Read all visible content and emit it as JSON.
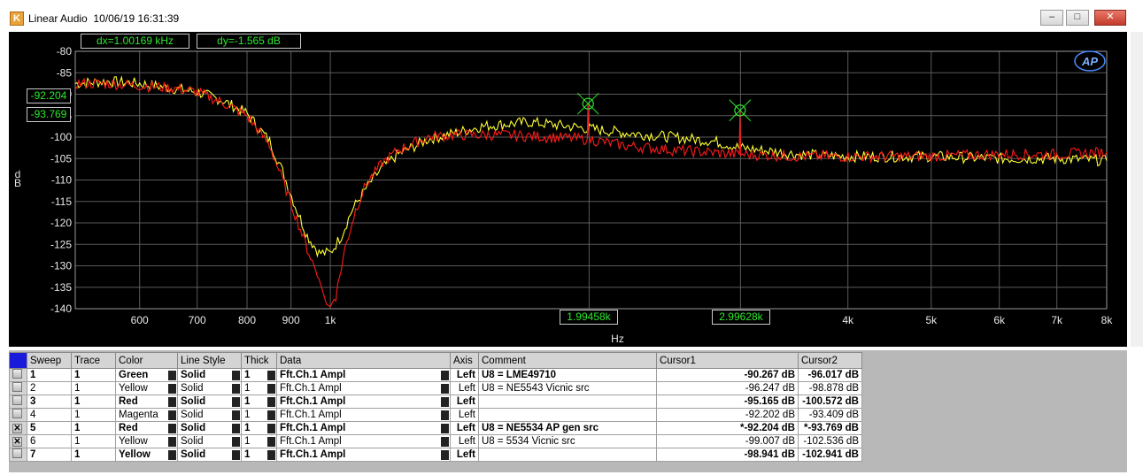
{
  "window": {
    "title": "Linear Audio",
    "timestamp": "10/06/19 16:31:39",
    "min": "–",
    "max": "□",
    "close": "✕"
  },
  "logo": "AP",
  "readouts": {
    "dx": "dx=1.00169 kHz",
    "dy": "dy=-1.565   dB",
    "cursor1_y": "-92.204",
    "cursor2_y": "-93.769",
    "cursor1_x": "1.99458k",
    "cursor2_x": "2.99628k"
  },
  "colors": {
    "yellow": "#ffff33",
    "red": "#ff1a1a",
    "green": "#2ee82e",
    "grid": "#5a5a5a"
  },
  "chart_data": {
    "type": "line",
    "xlabel": "Hz",
    "ylabel": "d\nB",
    "xscale": "log",
    "xlim": [
      505,
      8000
    ],
    "ylim": [
      -140,
      -80
    ],
    "yticks": [
      -80,
      -85,
      -90,
      -95,
      -100,
      -105,
      -110,
      -115,
      -120,
      -125,
      -130,
      -135,
      -140
    ],
    "xticks": [
      {
        "v": 600,
        "label": "600"
      },
      {
        "v": 700,
        "label": "700"
      },
      {
        "v": 800,
        "label": "800"
      },
      {
        "v": 900,
        "label": "900"
      },
      {
        "v": 1000,
        "label": "1k"
      },
      {
        "v": 2000,
        "label": ""
      },
      {
        "v": 3000,
        "label": ""
      },
      {
        "v": 4000,
        "label": "4k"
      },
      {
        "v": 5000,
        "label": "5k"
      },
      {
        "v": 6000,
        "label": "6k"
      },
      {
        "v": 7000,
        "label": "7k"
      },
      {
        "v": 8000,
        "label": "8k"
      }
    ],
    "cursors": [
      {
        "x": 1994.58,
        "y": -92.204
      },
      {
        "x": 2996.28,
        "y": -93.769
      }
    ],
    "series": [
      {
        "color": "yellow",
        "points": [
          [
            505,
            -87.5
          ],
          [
            550,
            -87
          ],
          [
            600,
            -87.5
          ],
          [
            650,
            -88.5
          ],
          [
            700,
            -89.5
          ],
          [
            750,
            -91.5
          ],
          [
            800,
            -94.5
          ],
          [
            850,
            -101
          ],
          [
            880,
            -108
          ],
          [
            910,
            -116
          ],
          [
            940,
            -123
          ],
          [
            970,
            -127
          ],
          [
            1000,
            -127
          ],
          [
            1030,
            -123
          ],
          [
            1060,
            -117
          ],
          [
            1100,
            -112
          ],
          [
            1150,
            -107
          ],
          [
            1200,
            -104
          ],
          [
            1300,
            -100.5
          ],
          [
            1400,
            -99
          ],
          [
            1500,
            -97.5
          ],
          [
            1600,
            -97
          ],
          [
            1700,
            -96.5
          ],
          [
            1800,
            -97
          ],
          [
            1994,
            -98
          ],
          [
            2200,
            -99
          ],
          [
            2500,
            -100
          ],
          [
            2800,
            -101
          ],
          [
            3000,
            -102.5
          ],
          [
            3500,
            -104
          ],
          [
            4000,
            -104.5
          ],
          [
            5000,
            -104.5
          ],
          [
            6000,
            -105
          ],
          [
            7000,
            -105
          ],
          [
            8000,
            -105.5
          ]
        ]
      },
      {
        "color": "red",
        "points": [
          [
            505,
            -87.5
          ],
          [
            550,
            -87.5
          ],
          [
            600,
            -88
          ],
          [
            650,
            -88.5
          ],
          [
            700,
            -89.5
          ],
          [
            750,
            -92
          ],
          [
            800,
            -95
          ],
          [
            850,
            -102
          ],
          [
            880,
            -110
          ],
          [
            910,
            -118
          ],
          [
            940,
            -126
          ],
          [
            970,
            -133
          ],
          [
            990,
            -139
          ],
          [
            1000,
            -139.5
          ],
          [
            1015,
            -137
          ],
          [
            1040,
            -126
          ],
          [
            1070,
            -117
          ],
          [
            1100,
            -111
          ],
          [
            1150,
            -106
          ],
          [
            1200,
            -103
          ],
          [
            1300,
            -100
          ],
          [
            1400,
            -99.5
          ],
          [
            1600,
            -99.5
          ],
          [
            1800,
            -100
          ],
          [
            1990,
            -100.5
          ],
          [
            1994,
            -92.2
          ],
          [
            1998,
            -100.5
          ],
          [
            2200,
            -102
          ],
          [
            2500,
            -103
          ],
          [
            2990,
            -104
          ],
          [
            2996,
            -93.8
          ],
          [
            3002,
            -104
          ],
          [
            3500,
            -104.5
          ],
          [
            4000,
            -104.5
          ],
          [
            5000,
            -104.5
          ],
          [
            6000,
            -104
          ],
          [
            7000,
            -104
          ],
          [
            8000,
            -103.5
          ]
        ]
      }
    ]
  },
  "table": {
    "headers": [
      "Sweep",
      "Trace",
      "Color",
      "Line Style",
      "Thick",
      "Data",
      "Axis",
      "Comment",
      "Cursor1",
      "Cursor2"
    ],
    "rows": [
      {
        "check": "",
        "sweep": "1",
        "trace": "1",
        "color": "Green",
        "style": "Solid",
        "thick": "1",
        "data": "Fft.Ch.1 Ampl",
        "axis": "Left",
        "comment": "U8 = LME49710",
        "c1": "-90.267  dB",
        "c2": "-96.017  dB",
        "bold": true
      },
      {
        "check": "",
        "sweep": "2",
        "trace": "1",
        "color": "Yellow",
        "style": "Solid",
        "thick": "1",
        "data": "Fft.Ch.1 Ampl",
        "axis": "Left",
        "comment": " U8 = NE5543 Vicnic src",
        "c1": "-96.247  dB",
        "c2": "-98.878  dB",
        "bold": false
      },
      {
        "check": "",
        "sweep": "3",
        "trace": "1",
        "color": "Red",
        "style": "Solid",
        "thick": "1",
        "data": "Fft.Ch.1 Ampl",
        "axis": "Left",
        "comment": "",
        "c1": "-95.165  dB",
        "c2": "-100.572 dB",
        "bold": true
      },
      {
        "check": "",
        "sweep": "4",
        "trace": "1",
        "color": "Magenta",
        "style": "Solid",
        "thick": "1",
        "data": "Fft.Ch.1 Ampl",
        "axis": "Left",
        "comment": "",
        "c1": "-92.202  dB",
        "c2": "-93.409  dB",
        "bold": false
      },
      {
        "check": "✕",
        "sweep": "5",
        "trace": "1",
        "color": "Red",
        "style": "Solid",
        "thick": "1",
        "data": "Fft.Ch.1 Ampl",
        "axis": "Left",
        "comment": "U8 = NE5534 AP gen src",
        "c1": "*-92.204  dB",
        "c2": "*-93.769  dB",
        "bold": true
      },
      {
        "check": "✕",
        "sweep": "6",
        "trace": "1",
        "color": "Yellow",
        "style": "Solid",
        "thick": "1",
        "data": "Fft.Ch.1 Ampl",
        "axis": "Left",
        "comment": "U8 = 5534 Vicnic src",
        "c1": "-99.007  dB",
        "c2": "-102.536 dB",
        "bold": false
      },
      {
        "check": "",
        "sweep": "7",
        "trace": "1",
        "color": "Yellow",
        "style": "Solid",
        "thick": "1",
        "data": "Fft.Ch.1 Ampl",
        "axis": "Left",
        "comment": "",
        "c1": "-98.941  dB",
        "c2": "-102.941 dB",
        "bold": true
      }
    ]
  }
}
